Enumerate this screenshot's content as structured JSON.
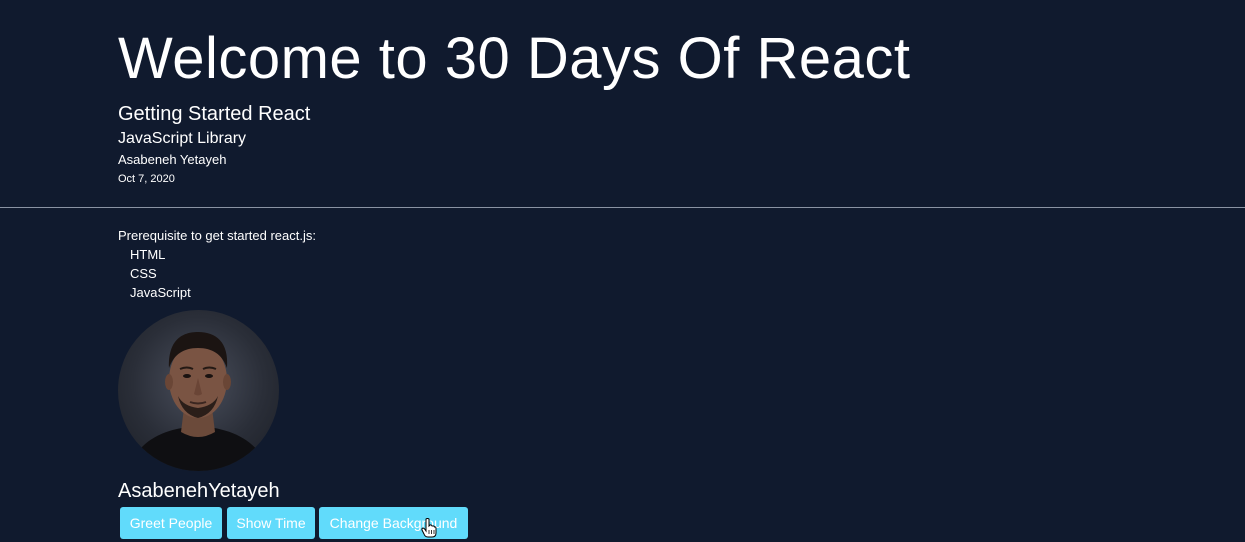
{
  "header": {
    "title": "Welcome to 30 Days Of React",
    "subtitle": "Getting Started React",
    "library": "JavaScript Library",
    "author": "Asabeneh Yetayeh",
    "date": "Oct 7, 2020"
  },
  "main": {
    "prerequisite_label": "Prerequisite to get started react.js:",
    "techs": [
      "HTML",
      "CSS",
      "JavaScript"
    ],
    "profile_name": "AsabenehYetayeh",
    "buttons": {
      "greet": "Greet People",
      "show_time": "Show Time",
      "change_background": "Change Background"
    }
  },
  "colors": {
    "background": "#101a2e",
    "button": "#61dbfb",
    "text": "#ffffff",
    "divider": "#8a93a3"
  },
  "icons": {
    "cursor": "hand-pointer-icon"
  }
}
